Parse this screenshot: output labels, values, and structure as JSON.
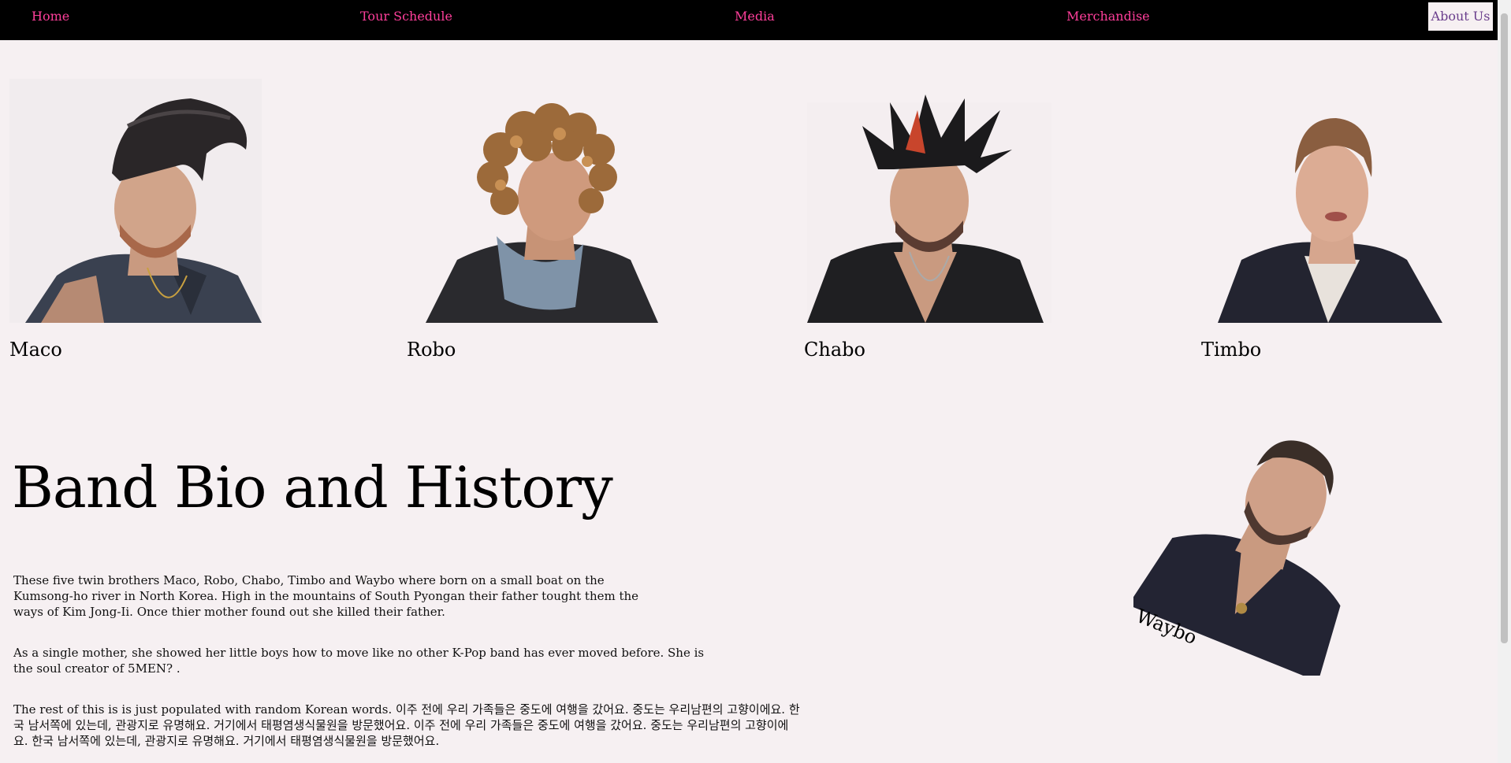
{
  "nav": {
    "home": "Home",
    "tour": "Tour Schedule",
    "media": "Media",
    "merch": "Merchandise",
    "about": "About Us"
  },
  "colors": {
    "nav_bg": "#000000",
    "nav_link": "#ff3f9b",
    "active_link": "#6a3e8c",
    "page_bg": "#f6f0f2"
  },
  "members": [
    {
      "name": "Maco",
      "photo": "maco-photo"
    },
    {
      "name": "Robo",
      "photo": "robo-photo"
    },
    {
      "name": "Chabo",
      "photo": "chabo-photo"
    },
    {
      "name": "Timbo",
      "photo": "timbo-photo"
    },
    {
      "name": "Waybo",
      "photo": "waybo-photo"
    }
  ],
  "bio": {
    "title": "Band Bio and History",
    "p1": "These five twin brothers Maco, Robo, Chabo, Timbo and Waybo where born on a small boat on the Kumsong-ho river in North Korea. High in the mountains of South Pyongan their father tought them the ways of Kim Jong-Ii. Once thier mother found out she killed their father.",
    "p2": "As a single mother, she showed her little boys how to move like no other K-Pop band has ever moved before. She is the soul creator of 5MEN? .",
    "p3": "The rest of this is is just populated with random Korean words. 이주 전에 우리 가족들은 중도에 여행을 갔어요. 중도는 우리남편의 고향이에요. 한국 남서쪽에 있는데, 관광지로 유명해요. 거기에서 태평염생식물원을 방문했어요. 이주 전에 우리 가족들은 중도에 여행을 갔어요. 중도는 우리남편의 고향이에요. 한국 남서쪽에 있는데, 관광지로 유명해요. 거기에서 태평염생식물원을 방문했어요."
  }
}
